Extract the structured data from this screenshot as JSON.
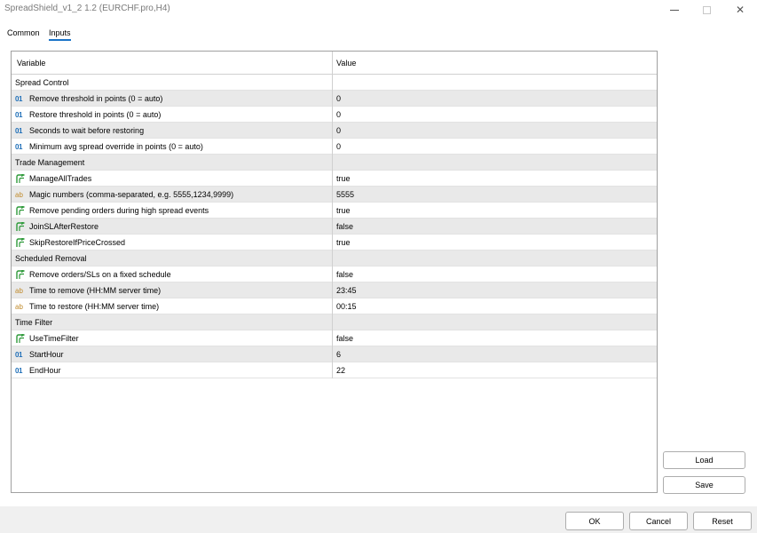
{
  "window": {
    "title": "SpreadShield_v1_2 1.2 (EURCHF.pro,H4)",
    "minimize_glyph": "—",
    "close_glyph": "✕"
  },
  "tabs": [
    {
      "label": "Common",
      "active": false
    },
    {
      "label": "Inputs",
      "active": true
    }
  ],
  "grid": {
    "columns": {
      "variable": "Variable",
      "value": "Value"
    },
    "rows": [
      {
        "type": "group",
        "variable": "Spread Control",
        "value": ""
      },
      {
        "type": "int",
        "icon": "int-icon",
        "variable": "Remove threshold in points (0 = auto)",
        "value": "0"
      },
      {
        "type": "int",
        "icon": "int-icon",
        "variable": "Restore threshold in points (0 = auto)",
        "value": "0"
      },
      {
        "type": "int",
        "icon": "int-icon",
        "variable": "Seconds to wait before restoring",
        "value": "0"
      },
      {
        "type": "int",
        "icon": "int-icon",
        "variable": "Minimum avg spread override in points (0 = auto)",
        "value": "0"
      },
      {
        "type": "group",
        "variable": "Trade Management",
        "value": ""
      },
      {
        "type": "bool",
        "icon": "bool-icon",
        "variable": "ManageAllTrades",
        "value": "true"
      },
      {
        "type": "string",
        "icon": "string-icon",
        "variable": "Magic numbers (comma-separated, e.g. 5555,1234,9999)",
        "value": "5555"
      },
      {
        "type": "bool",
        "icon": "bool-icon",
        "variable": "Remove pending orders during high spread events",
        "value": "true"
      },
      {
        "type": "bool",
        "icon": "bool-icon",
        "variable": "JoinSLAfterRestore",
        "value": "false"
      },
      {
        "type": "bool",
        "icon": "bool-icon",
        "variable": "SkipRestoreIfPriceCrossed",
        "value": "true"
      },
      {
        "type": "group",
        "variable": "Scheduled Removal",
        "value": ""
      },
      {
        "type": "bool",
        "icon": "bool-icon",
        "variable": "Remove orders/SLs on a fixed schedule",
        "value": "false"
      },
      {
        "type": "string",
        "icon": "string-icon",
        "variable": "Time to remove (HH:MM server time)",
        "value": "23:45"
      },
      {
        "type": "string",
        "icon": "string-icon",
        "variable": "Time to restore (HH:MM server time)",
        "value": "00:15"
      },
      {
        "type": "group",
        "variable": "Time Filter",
        "value": ""
      },
      {
        "type": "bool",
        "icon": "bool-icon",
        "variable": "UseTimeFilter",
        "value": "false"
      },
      {
        "type": "int",
        "icon": "int-icon",
        "variable": "StartHour",
        "value": "6"
      },
      {
        "type": "int",
        "icon": "int-icon",
        "variable": "EndHour",
        "value": "22"
      }
    ]
  },
  "icon_glyphs": {
    "int": "01",
    "string": "ab"
  },
  "side_buttons": {
    "load": "Load",
    "save": "Save"
  },
  "footer_buttons": {
    "ok": "OK",
    "cancel": "Cancel",
    "reset": "Reset"
  },
  "colors": {
    "accent": "#1a73c8",
    "int_icon": "#1f6fb8",
    "string_icon": "#c08a2a",
    "bool_icon": "#2e9a3a",
    "alt_row": "#e9e9e9"
  }
}
